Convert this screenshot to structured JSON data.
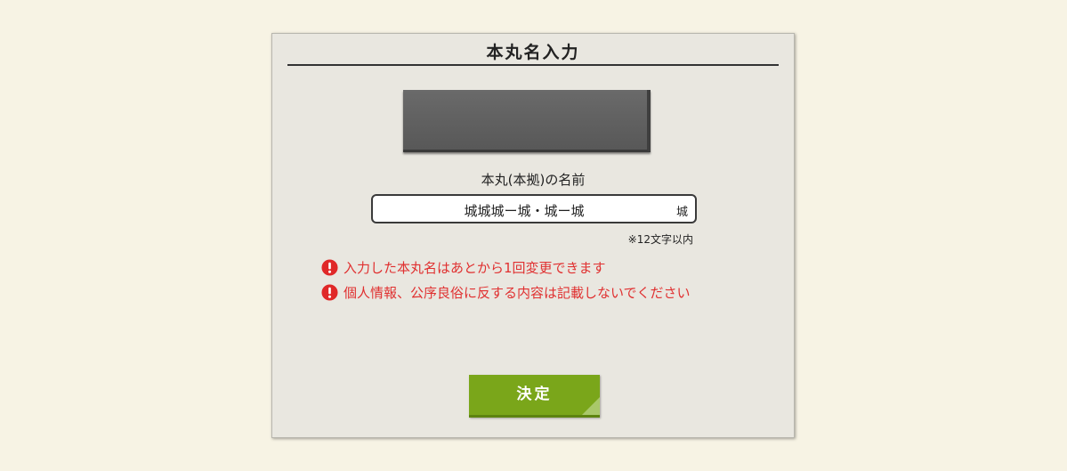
{
  "dialog": {
    "title": "本丸名入力",
    "field_label": "本丸(本拠)の名前",
    "input": {
      "value": "城城城ー城・城ー城",
      "suffix": "城"
    },
    "char_limit_note": "※12文字以内",
    "warnings": [
      "入力した本丸名はあとから1回変更できます",
      "個人情報、公序良俗に反する内容は記載しないでください"
    ],
    "confirm_button": "決定"
  },
  "colors": {
    "background": "#f7f3e4",
    "panel": "#e9e7e0",
    "warning_red": "#e03030",
    "button_green": "#7aa61a"
  },
  "icons": {
    "warning": "exclamation-circle-icon"
  }
}
